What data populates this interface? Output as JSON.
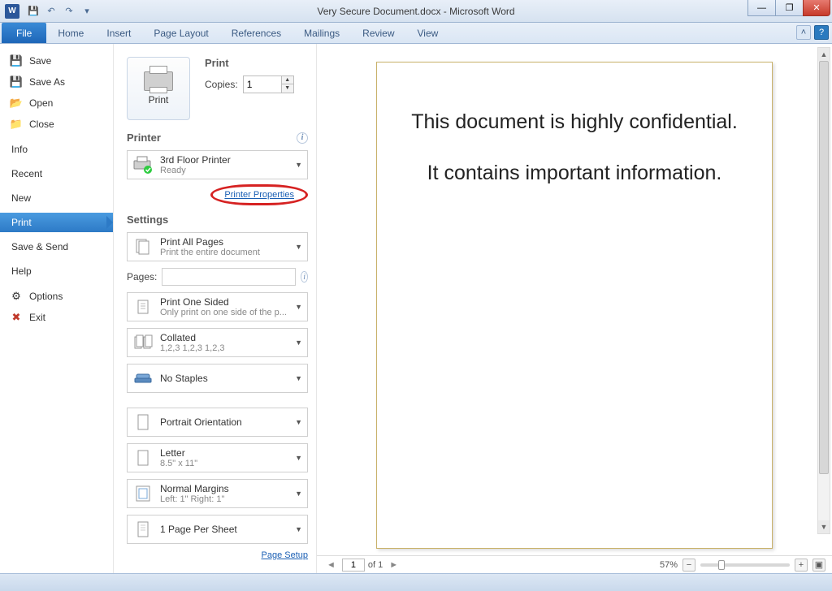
{
  "title": "Very Secure Document.docx - Microsoft Word",
  "appicon_letter": "W",
  "ribbon": {
    "file": "File",
    "tabs": [
      "Home",
      "Insert",
      "Page Layout",
      "References",
      "Mailings",
      "Review",
      "View"
    ]
  },
  "backstage": {
    "save": "Save",
    "saveas": "Save As",
    "open": "Open",
    "close": "Close",
    "info": "Info",
    "recent": "Recent",
    "new": "New",
    "print": "Print",
    "savesend": "Save & Send",
    "help": "Help",
    "options": "Options",
    "exit": "Exit"
  },
  "print": {
    "heading": "Print",
    "button_label": "Print",
    "copies_label": "Copies:",
    "copies_value": "1",
    "printer_heading": "Printer",
    "printer_name": "3rd Floor Printer",
    "printer_status": "Ready",
    "printer_properties": "Printer Properties",
    "settings_heading": "Settings",
    "pages_label": "Pages:",
    "page_setup": "Page Setup",
    "settings": {
      "scope_t": "Print All Pages",
      "scope_s": "Print the entire document",
      "sided_t": "Print One Sided",
      "sided_s": "Only print on one side of the p...",
      "collate_t": "Collated",
      "collate_s": "1,2,3   1,2,3   1,2,3",
      "staples_t": "No Staples",
      "orient_t": "Portrait Orientation",
      "paper_t": "Letter",
      "paper_s": "8.5\" x 11\"",
      "margins_t": "Normal Margins",
      "margins_s": "Left: 1\"    Right: 1\"",
      "pps_t": "1 Page Per Sheet"
    }
  },
  "preview": {
    "line1": "This document is highly confidential.",
    "line2": "It contains important information.",
    "page_current": "1",
    "page_of": "of 1",
    "zoom": "57%"
  }
}
